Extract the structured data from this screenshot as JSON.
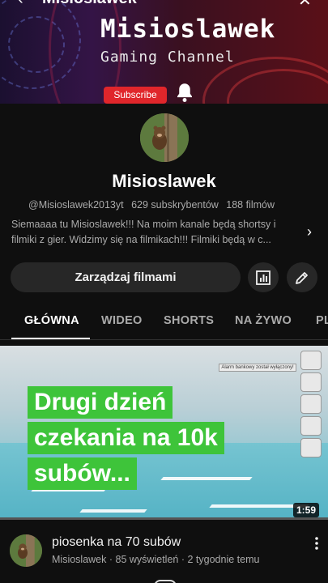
{
  "topbar": {
    "title": "Misioslawek"
  },
  "banner": {
    "title": "Misioslawek",
    "subtitle": "Gaming Channel",
    "subscribe_label": "Subscribe"
  },
  "channel": {
    "name": "Misioslawek",
    "handle": "@Misioslawek2013yt",
    "subscribers": "629 subskrybentów",
    "videos": "188 filmów",
    "description": "Siemaaaa tu Misioslawek!!! Na moim kanale będą shortsy i filmiki z gier. Widzimy się na filmikach!!! Filmiki będą w c...",
    "more_glyph": "›"
  },
  "actions": {
    "manage_label": "Zarządzaj filmami"
  },
  "tabs": [
    {
      "label": "GŁÓWNA",
      "active": true
    },
    {
      "label": "WIDEO",
      "active": false
    },
    {
      "label": "SHORTS",
      "active": false
    },
    {
      "label": "NA ŻYWO",
      "active": false
    },
    {
      "label": "PL",
      "active": false
    }
  ],
  "featured_video": {
    "overlay_lines": [
      "Drugi dzień",
      "czekania na 10k",
      "subów..."
    ],
    "duration": "1:59",
    "hud_text": "Alarm bankowy został wyłączony!"
  },
  "next_video": {
    "title": "piosenka na 70 subów",
    "channel": "Misioslawek",
    "views": "85 wyświetleń",
    "age": "2 tygodnie temu",
    "separator": "·"
  },
  "colors": {
    "background": "#0f0f0f",
    "button_bg": "#272727",
    "subscribe_red": "#e0262b",
    "overlay_green": "#3ec43a",
    "secondary_text": "#aaaaaa"
  }
}
